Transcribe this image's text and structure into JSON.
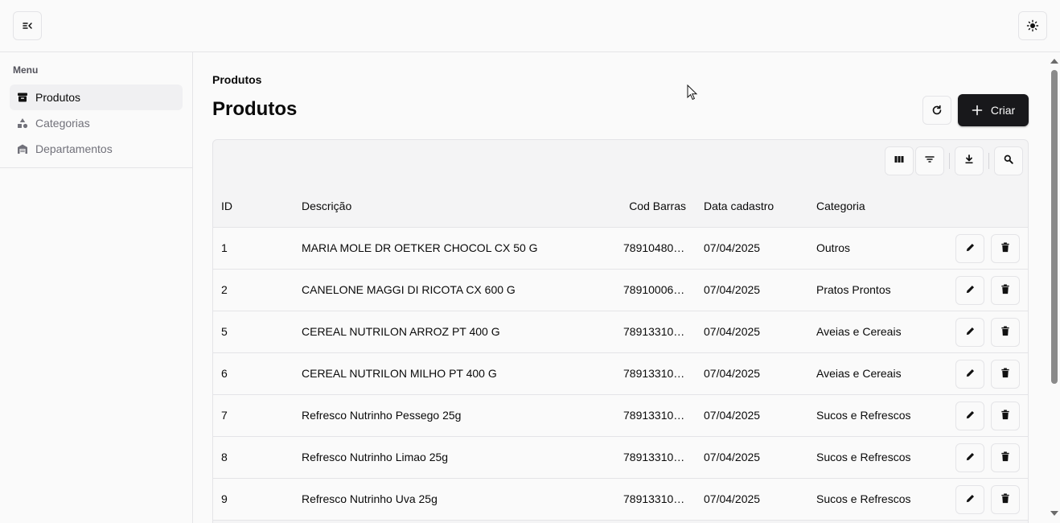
{
  "sidebar": {
    "menu_label": "Menu",
    "items": [
      {
        "label": "Produtos",
        "icon": "archive-icon",
        "active": true
      },
      {
        "label": "Categorias",
        "icon": "shapes-icon",
        "active": false
      },
      {
        "label": "Departamentos",
        "icon": "warehouse-icon",
        "active": false
      }
    ]
  },
  "header": {
    "breadcrumb": "Produtos",
    "title": "Produtos",
    "create_label": "Criar"
  },
  "table": {
    "columns": [
      "ID",
      "Descrição",
      "Cod Barras",
      "Data cadastro",
      "Categoria"
    ],
    "rows": [
      {
        "id": "1",
        "descricao": "MARIA MOLE DR OETKER CHOCOL CX 50 G",
        "cod_barras": "78910480…",
        "data": "07/04/2025",
        "categoria": "Outros"
      },
      {
        "id": "2",
        "descricao": "CANELONE MAGGI DI RICOTA CX 600 G",
        "cod_barras": "78910006…",
        "data": "07/04/2025",
        "categoria": "Pratos Prontos"
      },
      {
        "id": "5",
        "descricao": "CEREAL NUTRILON ARROZ PT 400 G",
        "cod_barras": "78913310…",
        "data": "07/04/2025",
        "categoria": "Aveias e Cereais"
      },
      {
        "id": "6",
        "descricao": "CEREAL NUTRILON MILHO PT 400 G",
        "cod_barras": "78913310…",
        "data": "07/04/2025",
        "categoria": "Aveias e Cereais"
      },
      {
        "id": "7",
        "descricao": "Refresco Nutrinho Pessego 25g",
        "cod_barras": "78913310…",
        "data": "07/04/2025",
        "categoria": "Sucos e Refrescos"
      },
      {
        "id": "8",
        "descricao": "Refresco Nutrinho Limao 25g",
        "cod_barras": "78913310…",
        "data": "07/04/2025",
        "categoria": "Sucos e Refrescos"
      },
      {
        "id": "9",
        "descricao": "Refresco Nutrinho Uva 25g",
        "cod_barras": "78913310…",
        "data": "07/04/2025",
        "categoria": "Sucos e Refrescos"
      }
    ]
  },
  "colors": {
    "primary": "#18181b",
    "border": "#e4e4e7",
    "muted": "#71717a"
  }
}
